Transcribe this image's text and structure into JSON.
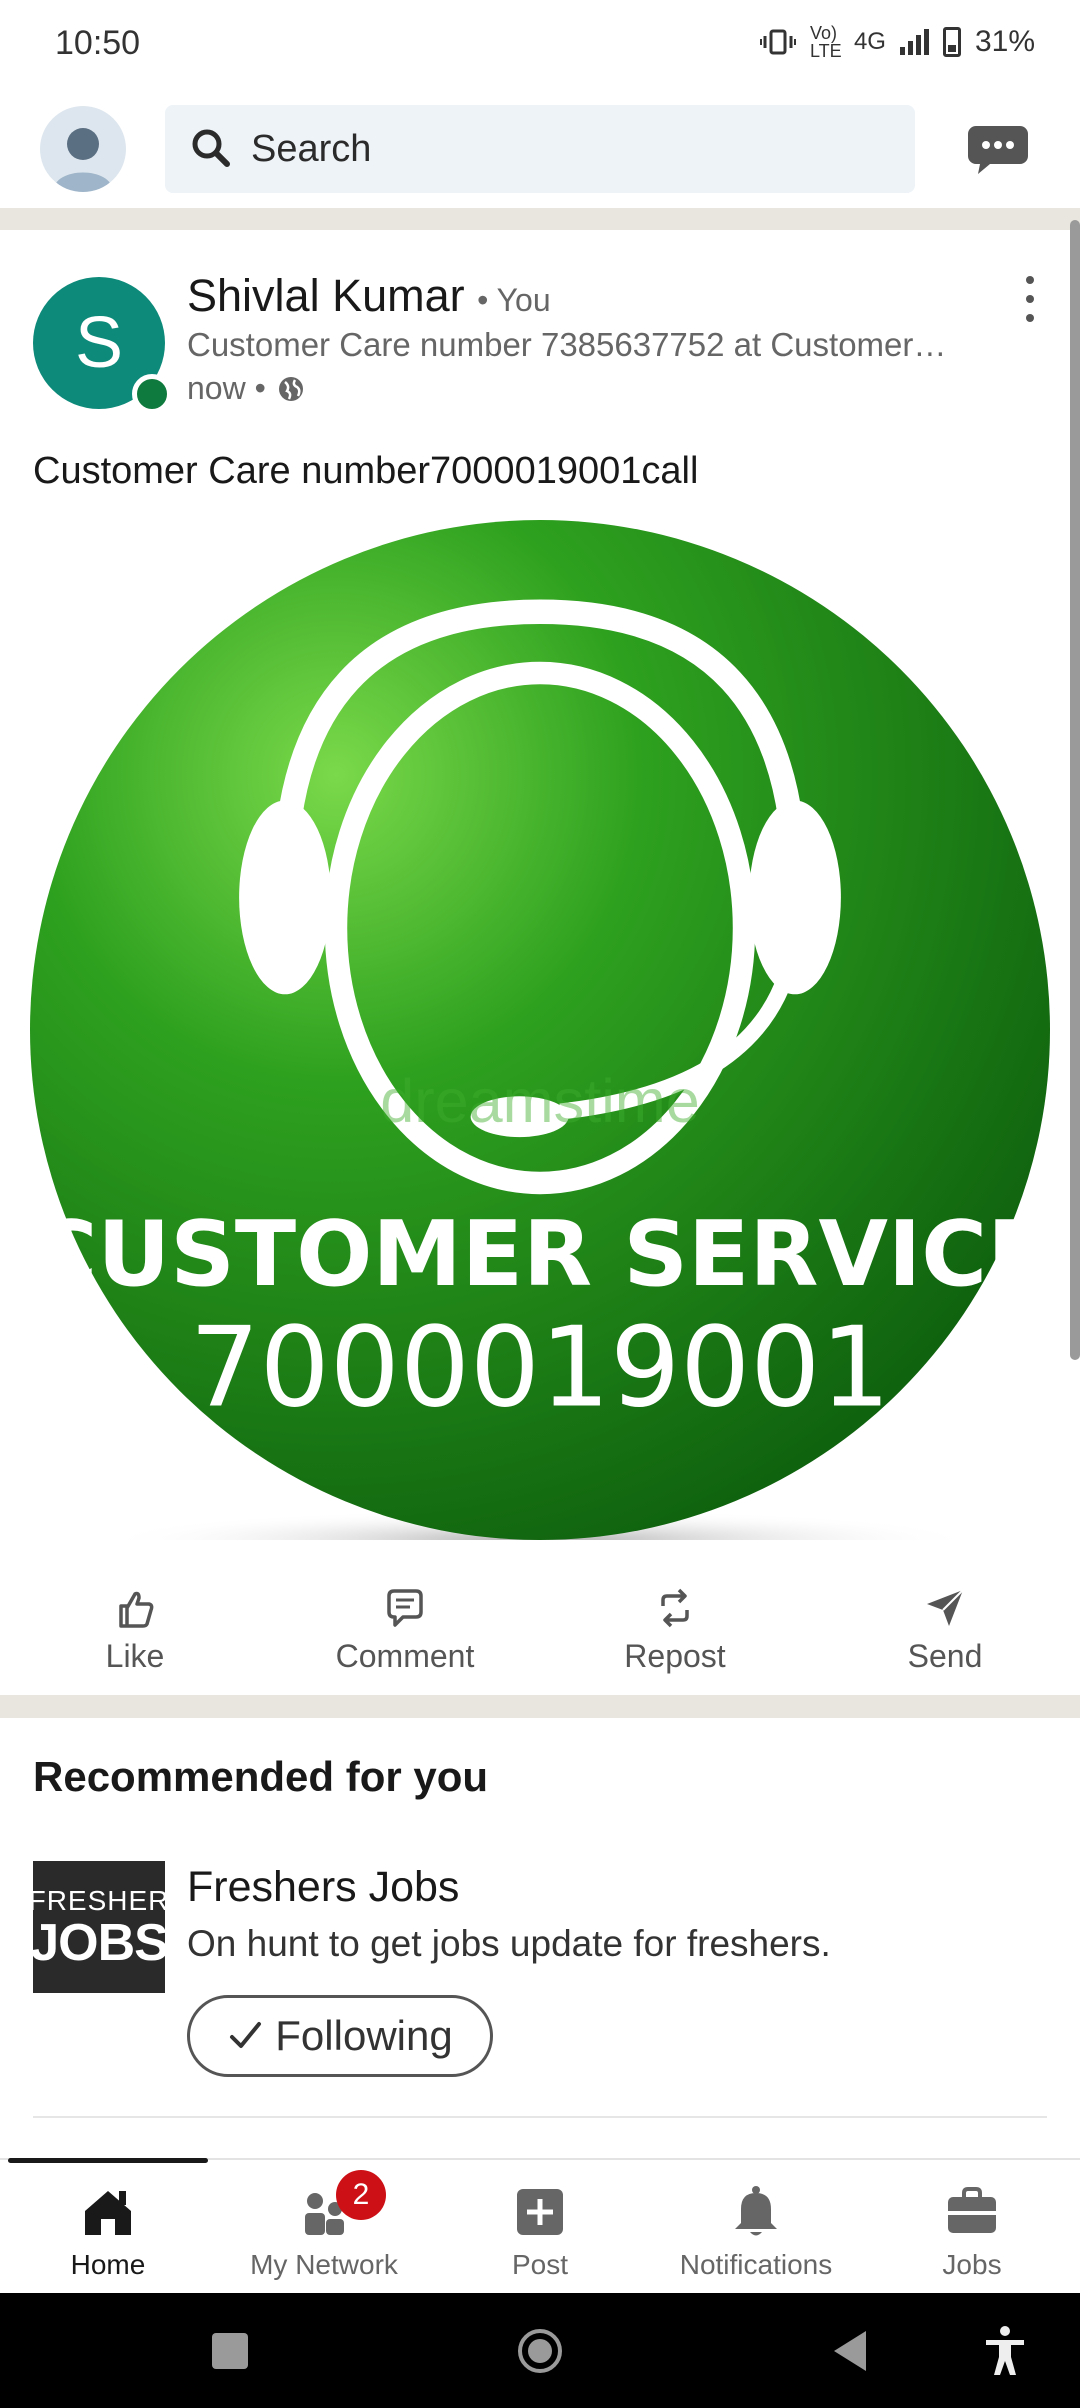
{
  "status_bar": {
    "time": "10:50",
    "network": "4G",
    "volte": "Vo) LTE",
    "battery": "31%"
  },
  "topbar": {
    "search_placeholder": "Search"
  },
  "post": {
    "avatar_initial": "S",
    "author": "Shivlal Kumar",
    "you_label": "• You",
    "headline": "Customer Care number 7385637752 at Customer …",
    "time": "now •",
    "text": "Customer Care number7000019001call",
    "image": {
      "line1": "CUSTOMER SERVICE",
      "line2": "7000019001",
      "watermark": "dreamstime"
    },
    "actions": [
      "Like",
      "Comment",
      "Repost",
      "Send"
    ]
  },
  "recommended": {
    "title": "Recommended for you",
    "items": [
      {
        "logo_line1": "FRESHER",
        "logo_line2": "JOBS",
        "name": "Freshers Jobs",
        "description": "On hunt to get jobs update for freshers.",
        "button": "Following"
      }
    ]
  },
  "bottom_nav": {
    "items": [
      {
        "label": "Home",
        "icon": "home-icon"
      },
      {
        "label": "My Network",
        "icon": "people-icon",
        "badge": "2"
      },
      {
        "label": "Post",
        "icon": "plus-square-icon"
      },
      {
        "label": "Notifications",
        "icon": "bell-icon"
      },
      {
        "label": "Jobs",
        "icon": "briefcase-icon"
      }
    ]
  },
  "colors": {
    "brand_green": "#1a8a1a",
    "teal_avatar": "#0e8a7a",
    "badge_red": "#cc1016",
    "online_green": "#0f7a3d"
  }
}
